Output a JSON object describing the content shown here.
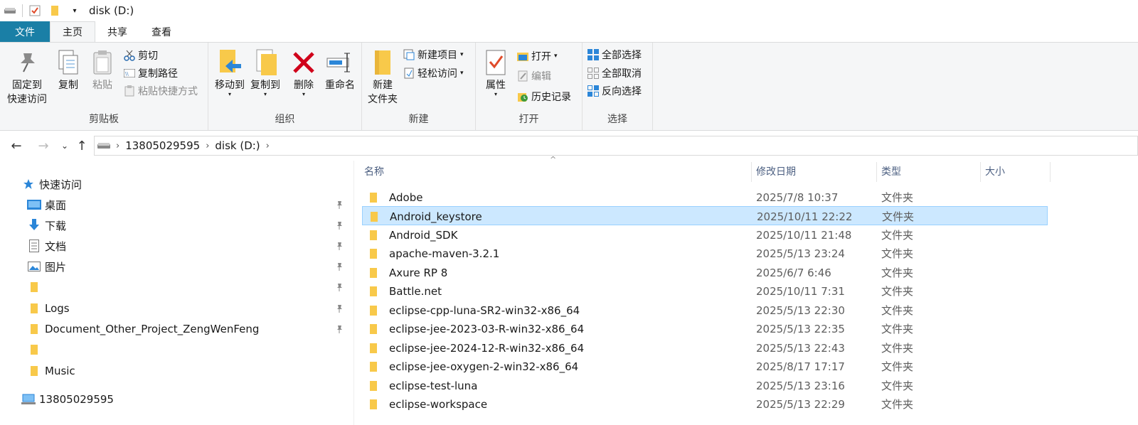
{
  "window": {
    "title": "disk (D:)"
  },
  "tabs": [
    {
      "label": "文件"
    },
    {
      "label": "主页"
    },
    {
      "label": "共享"
    },
    {
      "label": "查看"
    }
  ],
  "ribbon": {
    "clipboard": {
      "pin_label": "固定到\n快速访问",
      "copy_label": "复制",
      "paste_label": "粘贴",
      "cut_label": "剪切",
      "copy_path_label": "复制路径",
      "paste_shortcut_label": "粘贴快捷方式",
      "group_label": "剪贴板"
    },
    "organize": {
      "move_label": "移动到",
      "copyto_label": "复制到",
      "delete_label": "删除",
      "rename_label": "重命名",
      "group_label": "组织"
    },
    "new": {
      "newfolder_label": "新建\n文件夹",
      "newitem_label": "新建项目",
      "easyaccess_label": "轻松访问",
      "group_label": "新建"
    },
    "open": {
      "properties_label": "属性",
      "open_label": "打开",
      "edit_label": "编辑",
      "history_label": "历史记录",
      "group_label": "打开"
    },
    "select": {
      "selectall_label": "全部选择",
      "selectnone_label": "全部取消",
      "invert_label": "反向选择",
      "group_label": "选择"
    }
  },
  "address": {
    "crumbs": [
      "13805029595",
      "disk (D:)"
    ]
  },
  "nav": {
    "quick_access": "快速访问",
    "items": [
      {
        "label": "桌面",
        "pinned": true
      },
      {
        "label": "下载",
        "pinned": true
      },
      {
        "label": "文档",
        "pinned": true
      },
      {
        "label": "图片",
        "pinned": true
      },
      {
        "label": "",
        "pinned": true
      },
      {
        "label": "Logs",
        "pinned": true
      },
      {
        "label": "Document_Other_Project_ZengWenFeng",
        "pinned": true
      },
      {
        "label": "",
        "pinned": false
      },
      {
        "label": "Music",
        "pinned": false
      }
    ],
    "this_pc": "13805029595"
  },
  "columns": {
    "name": "名称",
    "modified": "修改日期",
    "type": "类型",
    "size": "大小"
  },
  "files": [
    {
      "name": "Adobe",
      "modified": "2025/7/8 10:37",
      "type": "文件夹"
    },
    {
      "name": "Android_keystore",
      "modified": "2025/10/11 22:22",
      "type": "文件夹",
      "selected": true
    },
    {
      "name": "Android_SDK",
      "modified": "2025/10/11 21:48",
      "type": "文件夹"
    },
    {
      "name": "apache-maven-3.2.1",
      "modified": "2025/5/13 23:24",
      "type": "文件夹"
    },
    {
      "name": "Axure RP 8",
      "modified": "2025/6/7 6:46",
      "type": "文件夹"
    },
    {
      "name": "Battle.net",
      "modified": "2025/10/11 7:31",
      "type": "文件夹"
    },
    {
      "name": "eclipse-cpp-luna-SR2-win32-x86_64",
      "modified": "2025/5/13 22:30",
      "type": "文件夹"
    },
    {
      "name": "eclipse-jee-2023-03-R-win32-x86_64",
      "modified": "2025/5/13 22:35",
      "type": "文件夹"
    },
    {
      "name": "eclipse-jee-2024-12-R-win32-x86_64",
      "modified": "2025/5/13 22:43",
      "type": "文件夹"
    },
    {
      "name": "eclipse-jee-oxygen-2-win32-x86_64",
      "modified": "2025/8/17 17:17",
      "type": "文件夹"
    },
    {
      "name": "eclipse-test-luna",
      "modified": "2025/5/13 23:16",
      "type": "文件夹"
    },
    {
      "name": "eclipse-workspace",
      "modified": "2025/5/13 22:29",
      "type": "文件夹"
    }
  ],
  "colors": {
    "accent": "#1a7fa6",
    "selection": "#cce8ff",
    "folder": "#f8c94a"
  }
}
